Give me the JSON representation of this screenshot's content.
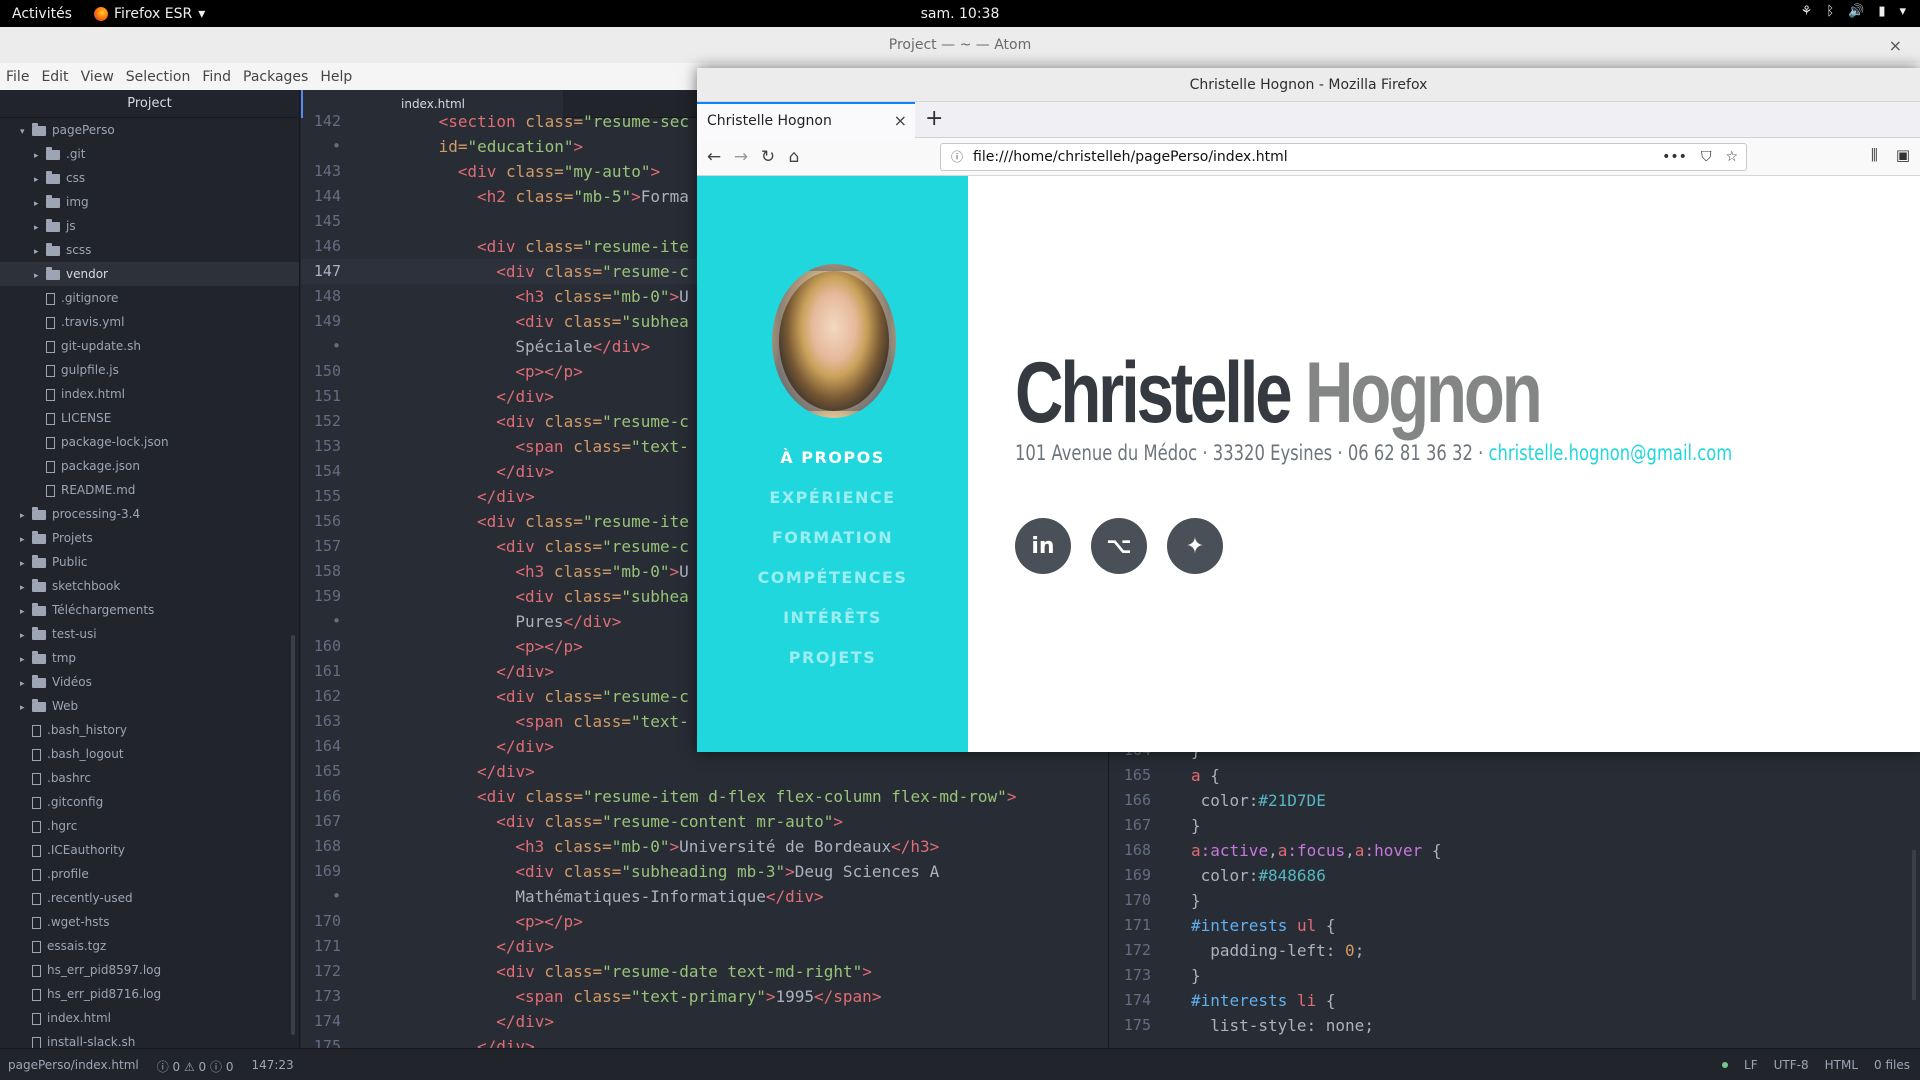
{
  "topbar": {
    "activities": "Activités",
    "app_name": "Firefox ESR",
    "clock": "sam. 10:38",
    "tray": {
      "accessibility": "⚘",
      "bluetooth": "ᛒ",
      "volume": "🔊",
      "battery": "▮"
    }
  },
  "atom": {
    "title": "Project — ~ — Atom",
    "close": "×",
    "menu": [
      "File",
      "Edit",
      "View",
      "Selection",
      "Find",
      "Packages",
      "Help"
    ],
    "tree": {
      "header": "Project",
      "items": [
        {
          "label": "pagePerso",
          "type": "folder",
          "open": true,
          "depth": 0
        },
        {
          "label": ".git",
          "type": "folder",
          "depth": 1
        },
        {
          "label": "css",
          "type": "folder",
          "depth": 1
        },
        {
          "label": "img",
          "type": "folder",
          "depth": 1
        },
        {
          "label": "js",
          "type": "folder",
          "depth": 1
        },
        {
          "label": "scss",
          "type": "folder",
          "depth": 1
        },
        {
          "label": "vendor",
          "type": "folder",
          "depth": 1,
          "selected": true
        },
        {
          "label": ".gitignore",
          "type": "file",
          "depth": 1
        },
        {
          "label": ".travis.yml",
          "type": "file",
          "depth": 1
        },
        {
          "label": "git-update.sh",
          "type": "file",
          "depth": 1
        },
        {
          "label": "gulpfile.js",
          "type": "file",
          "depth": 1
        },
        {
          "label": "index.html",
          "type": "file",
          "depth": 1
        },
        {
          "label": "LICENSE",
          "type": "file",
          "depth": 1
        },
        {
          "label": "package-lock.json",
          "type": "file",
          "depth": 1
        },
        {
          "label": "package.json",
          "type": "file",
          "depth": 1
        },
        {
          "label": "README.md",
          "type": "file",
          "depth": 1
        },
        {
          "label": "processing-3.4",
          "type": "folder",
          "depth": 0
        },
        {
          "label": "Projets",
          "type": "folder",
          "depth": 0
        },
        {
          "label": "Public",
          "type": "folder",
          "depth": 0
        },
        {
          "label": "sketchbook",
          "type": "folder",
          "depth": 0
        },
        {
          "label": "Téléchargements",
          "type": "folder",
          "depth": 0
        },
        {
          "label": "test-usi",
          "type": "folder",
          "depth": 0
        },
        {
          "label": "tmp",
          "type": "folder",
          "depth": 0
        },
        {
          "label": "Vidéos",
          "type": "folder",
          "depth": 0
        },
        {
          "label": "Web",
          "type": "folder",
          "depth": 0
        },
        {
          "label": ".bash_history",
          "type": "file",
          "depth": 0
        },
        {
          "label": ".bash_logout",
          "type": "file",
          "depth": 0
        },
        {
          "label": ".bashrc",
          "type": "file",
          "depth": 0
        },
        {
          "label": ".gitconfig",
          "type": "file",
          "depth": 0
        },
        {
          "label": ".hgrc",
          "type": "file",
          "depth": 0
        },
        {
          "label": ".ICEauthority",
          "type": "file",
          "depth": 0
        },
        {
          "label": ".profile",
          "type": "file",
          "depth": 0
        },
        {
          "label": ".recently-used",
          "type": "file",
          "depth": 0
        },
        {
          "label": ".wget-hsts",
          "type": "file",
          "depth": 0
        },
        {
          "label": "essais.tgz",
          "type": "file",
          "depth": 0
        },
        {
          "label": "hs_err_pid8597.log",
          "type": "file",
          "depth": 0
        },
        {
          "label": "hs_err_pid8716.log",
          "type": "file",
          "depth": 0
        },
        {
          "label": "index.html",
          "type": "file",
          "depth": 0
        },
        {
          "label": "install-slack.sh",
          "type": "file",
          "depth": 0
        }
      ]
    },
    "tab": {
      "label": "index.html"
    },
    "html_lines": [
      {
        "n": "142",
        "ind": 6,
        "seg": [
          [
            "tag",
            "<section "
          ],
          [
            "attr",
            "class="
          ],
          [
            "str",
            "\"resume-sec"
          ]
        ]
      },
      {
        "n": "•",
        "ind": 6,
        "seg": [
          [
            "attr",
            "id="
          ],
          [
            "str",
            "\"education\""
          ],
          [
            "tag",
            ">"
          ]
        ]
      },
      {
        "n": "143",
        "ind": 8,
        "seg": [
          [
            "tag",
            "<div "
          ],
          [
            "attr",
            "class="
          ],
          [
            "str",
            "\"my-auto\""
          ],
          [
            "tag",
            ">"
          ]
        ]
      },
      {
        "n": "144",
        "ind": 10,
        "seg": [
          [
            "tag",
            "<h2 "
          ],
          [
            "attr",
            "class="
          ],
          [
            "str",
            "\"mb-5\""
          ],
          [
            "tag",
            ">"
          ],
          [
            "txt",
            "Forma"
          ]
        ]
      },
      {
        "n": "145",
        "ind": 0,
        "seg": []
      },
      {
        "n": "146",
        "ind": 10,
        "seg": [
          [
            "tag",
            "<div "
          ],
          [
            "attr",
            "class="
          ],
          [
            "str",
            "\"resume-ite"
          ]
        ]
      },
      {
        "n": "147",
        "ind": 12,
        "cur": true,
        "seg": [
          [
            "tag",
            "<div "
          ],
          [
            "attr",
            "class="
          ],
          [
            "str",
            "\"resume-c"
          ]
        ]
      },
      {
        "n": "148",
        "ind": 14,
        "seg": [
          [
            "tag",
            "<h3 "
          ],
          [
            "attr",
            "class="
          ],
          [
            "str",
            "\"mb-0\""
          ],
          [
            "tag",
            ">"
          ],
          [
            "txt",
            "U"
          ]
        ]
      },
      {
        "n": "149",
        "ind": 14,
        "seg": [
          [
            "tag",
            "<div "
          ],
          [
            "attr",
            "class="
          ],
          [
            "str",
            "\"subhea"
          ]
        ]
      },
      {
        "n": "•",
        "ind": 14,
        "seg": [
          [
            "txt",
            "Spéciale"
          ],
          [
            "tag",
            "</div>"
          ]
        ]
      },
      {
        "n": "150",
        "ind": 14,
        "seg": [
          [
            "tag",
            "<p></p>"
          ]
        ]
      },
      {
        "n": "151",
        "ind": 12,
        "seg": [
          [
            "tag",
            "</div>"
          ]
        ]
      },
      {
        "n": "152",
        "ind": 12,
        "seg": [
          [
            "tag",
            "<div "
          ],
          [
            "attr",
            "class="
          ],
          [
            "str",
            "\"resume-c"
          ]
        ]
      },
      {
        "n": "153",
        "ind": 14,
        "seg": [
          [
            "tag",
            "<span "
          ],
          [
            "attr",
            "class="
          ],
          [
            "str",
            "\"text-"
          ]
        ]
      },
      {
        "n": "154",
        "ind": 12,
        "seg": [
          [
            "tag",
            "</div>"
          ]
        ]
      },
      {
        "n": "155",
        "ind": 10,
        "seg": [
          [
            "tag",
            "</div>"
          ]
        ]
      },
      {
        "n": "156",
        "ind": 10,
        "seg": [
          [
            "tag",
            "<div "
          ],
          [
            "attr",
            "class="
          ],
          [
            "str",
            "\"resume-ite"
          ]
        ]
      },
      {
        "n": "157",
        "ind": 12,
        "seg": [
          [
            "tag",
            "<div "
          ],
          [
            "attr",
            "class="
          ],
          [
            "str",
            "\"resume-c"
          ]
        ]
      },
      {
        "n": "158",
        "ind": 14,
        "seg": [
          [
            "tag",
            "<h3 "
          ],
          [
            "attr",
            "class="
          ],
          [
            "str",
            "\"mb-0\""
          ],
          [
            "tag",
            ">"
          ],
          [
            "txt",
            "U"
          ]
        ]
      },
      {
        "n": "159",
        "ind": 14,
        "seg": [
          [
            "tag",
            "<div "
          ],
          [
            "attr",
            "class="
          ],
          [
            "str",
            "\"subhea"
          ]
        ]
      },
      {
        "n": "•",
        "ind": 14,
        "seg": [
          [
            "txt",
            "Pures"
          ],
          [
            "tag",
            "</div>"
          ]
        ]
      },
      {
        "n": "160",
        "ind": 14,
        "seg": [
          [
            "tag",
            "<p></p>"
          ]
        ]
      },
      {
        "n": "161",
        "ind": 12,
        "seg": [
          [
            "tag",
            "</div>"
          ]
        ]
      },
      {
        "n": "162",
        "ind": 12,
        "seg": [
          [
            "tag",
            "<div "
          ],
          [
            "attr",
            "class="
          ],
          [
            "str",
            "\"resume-c"
          ]
        ]
      },
      {
        "n": "163",
        "ind": 14,
        "seg": [
          [
            "tag",
            "<span "
          ],
          [
            "attr",
            "class="
          ],
          [
            "str",
            "\"text-"
          ]
        ]
      },
      {
        "n": "164",
        "ind": 12,
        "seg": [
          [
            "tag",
            "</div>"
          ]
        ]
      },
      {
        "n": "165",
        "ind": 10,
        "seg": [
          [
            "tag",
            "</div>"
          ]
        ]
      },
      {
        "n": "166",
        "ind": 10,
        "seg": [
          [
            "tag",
            "<div "
          ],
          [
            "attr",
            "class="
          ],
          [
            "str",
            "\"resume-item d-flex flex-column flex-md-row\""
          ],
          [
            "tag",
            ">"
          ]
        ]
      },
      {
        "n": "167",
        "ind": 12,
        "seg": [
          [
            "tag",
            "<div "
          ],
          [
            "attr",
            "class="
          ],
          [
            "str",
            "\"resume-content mr-auto\""
          ],
          [
            "tag",
            ">"
          ]
        ]
      },
      {
        "n": "168",
        "ind": 14,
        "seg": [
          [
            "tag",
            "<h3 "
          ],
          [
            "attr",
            "class="
          ],
          [
            "str",
            "\"mb-0\""
          ],
          [
            "tag",
            ">"
          ],
          [
            "txt",
            "Université de Bordeaux"
          ],
          [
            "tag",
            "</h3>"
          ]
        ]
      },
      {
        "n": "169",
        "ind": 14,
        "seg": [
          [
            "tag",
            "<div "
          ],
          [
            "attr",
            "class="
          ],
          [
            "str",
            "\"subheading mb-3\""
          ],
          [
            "tag",
            ">"
          ],
          [
            "txt",
            "Deug Sciences A"
          ]
        ]
      },
      {
        "n": "•",
        "ind": 14,
        "seg": [
          [
            "txt",
            "Mathématiques-Informatique"
          ],
          [
            "tag",
            "</div>"
          ]
        ]
      },
      {
        "n": "170",
        "ind": 14,
        "seg": [
          [
            "tag",
            "<p></p>"
          ]
        ]
      },
      {
        "n": "171",
        "ind": 12,
        "seg": [
          [
            "tag",
            "</div>"
          ]
        ]
      },
      {
        "n": "172",
        "ind": 12,
        "seg": [
          [
            "tag",
            "<div "
          ],
          [
            "attr",
            "class="
          ],
          [
            "str",
            "\"resume-date text-md-right\""
          ],
          [
            "tag",
            ">"
          ]
        ]
      },
      {
        "n": "173",
        "ind": 14,
        "seg": [
          [
            "tag",
            "<span "
          ],
          [
            "attr",
            "class="
          ],
          [
            "str",
            "\"text-primary\""
          ],
          [
            "tag",
            ">"
          ],
          [
            "txt",
            "1995"
          ],
          [
            "tag",
            "</span>"
          ]
        ]
      },
      {
        "n": "174",
        "ind": 12,
        "seg": [
          [
            "tag",
            "</div>"
          ]
        ]
      },
      {
        "n": "175",
        "ind": 10,
        "seg": [
          [
            "tag",
            "</div>"
          ]
        ]
      }
    ],
    "css_lines": [
      {
        "n": "164",
        "ind": 0,
        "seg": [
          [
            "txt",
            "}"
          ]
        ]
      },
      {
        "n": "165",
        "ind": 0,
        "seg": [
          [
            "sel",
            "a"
          ],
          [
            "txt",
            " {"
          ]
        ]
      },
      {
        "n": "166",
        "ind": 1,
        "seg": [
          [
            "prop",
            "color:"
          ],
          [
            "hex",
            "#21D7DE"
          ]
        ]
      },
      {
        "n": "167",
        "ind": 0,
        "seg": [
          [
            "txt",
            "}"
          ]
        ]
      },
      {
        "n": "168",
        "ind": 0,
        "seg": [
          [
            "sel",
            "a"
          ],
          [
            "ps",
            ":active"
          ],
          [
            "txt",
            ","
          ],
          [
            "sel",
            "a"
          ],
          [
            "ps",
            ":focus"
          ],
          [
            "txt",
            ","
          ],
          [
            "sel",
            "a"
          ],
          [
            "ps",
            ":hover"
          ],
          [
            "txt",
            " {"
          ]
        ]
      },
      {
        "n": "169",
        "ind": 1,
        "seg": [
          [
            "prop",
            "color:"
          ],
          [
            "hex",
            "#848686"
          ]
        ]
      },
      {
        "n": "170",
        "ind": 0,
        "seg": [
          [
            "txt",
            "}"
          ]
        ]
      },
      {
        "n": "171",
        "ind": 0,
        "seg": [
          [
            "id",
            "#interests"
          ],
          [
            "txt",
            " "
          ],
          [
            "sel",
            "ul"
          ],
          [
            "txt",
            " {"
          ]
        ]
      },
      {
        "n": "172",
        "ind": 2,
        "seg": [
          [
            "prop",
            "padding-left: "
          ],
          [
            "num",
            "0"
          ],
          [
            "txt",
            ";"
          ]
        ]
      },
      {
        "n": "173",
        "ind": 0,
        "seg": [
          [
            "txt",
            "}"
          ]
        ]
      },
      {
        "n": "174",
        "ind": 0,
        "seg": [
          [
            "id",
            "#interests"
          ],
          [
            "txt",
            " "
          ],
          [
            "sel",
            "li"
          ],
          [
            "txt",
            " {"
          ]
        ]
      },
      {
        "n": "175",
        "ind": 2,
        "seg": [
          [
            "prop",
            "list-style: none;"
          ]
        ]
      }
    ],
    "status": {
      "path": "pagePerso/index.html",
      "diagnostics": "ⓘ 0 ⚠ 0 ⓘ 0",
      "cursor": "147:23",
      "line_ending": "LF",
      "encoding": "UTF-8",
      "grammar": "HTML",
      "files": "0 files"
    }
  },
  "firefox": {
    "window_title": "Christelle Hognon - Mozilla Firefox",
    "tab_title": "Christelle Hognon",
    "tab_close": "×",
    "new_tab": "+",
    "url": "file:///home/christelleh/pagePerso/index.html",
    "page": {
      "first_name": "Christelle",
      "last_name": "Hognon",
      "address": "101 Avenue du Médoc · 33320 Eysines · 06 62 81 36 32 · ",
      "email": "christelle.hognon@gmail.com",
      "nav": [
        "À PROPOS",
        "EXPÉRIENCE",
        "FORMATION",
        "COMPÉTENCES",
        "INTÉRÊTS",
        "PROJETS"
      ],
      "socials": [
        {
          "name": "linkedin-icon",
          "glyph": "in"
        },
        {
          "name": "github-icon",
          "glyph": "⌥"
        },
        {
          "name": "twitter-icon",
          "glyph": "✦"
        }
      ],
      "colors": {
        "primary": "#21d7de",
        "hover": "#848686"
      }
    }
  }
}
